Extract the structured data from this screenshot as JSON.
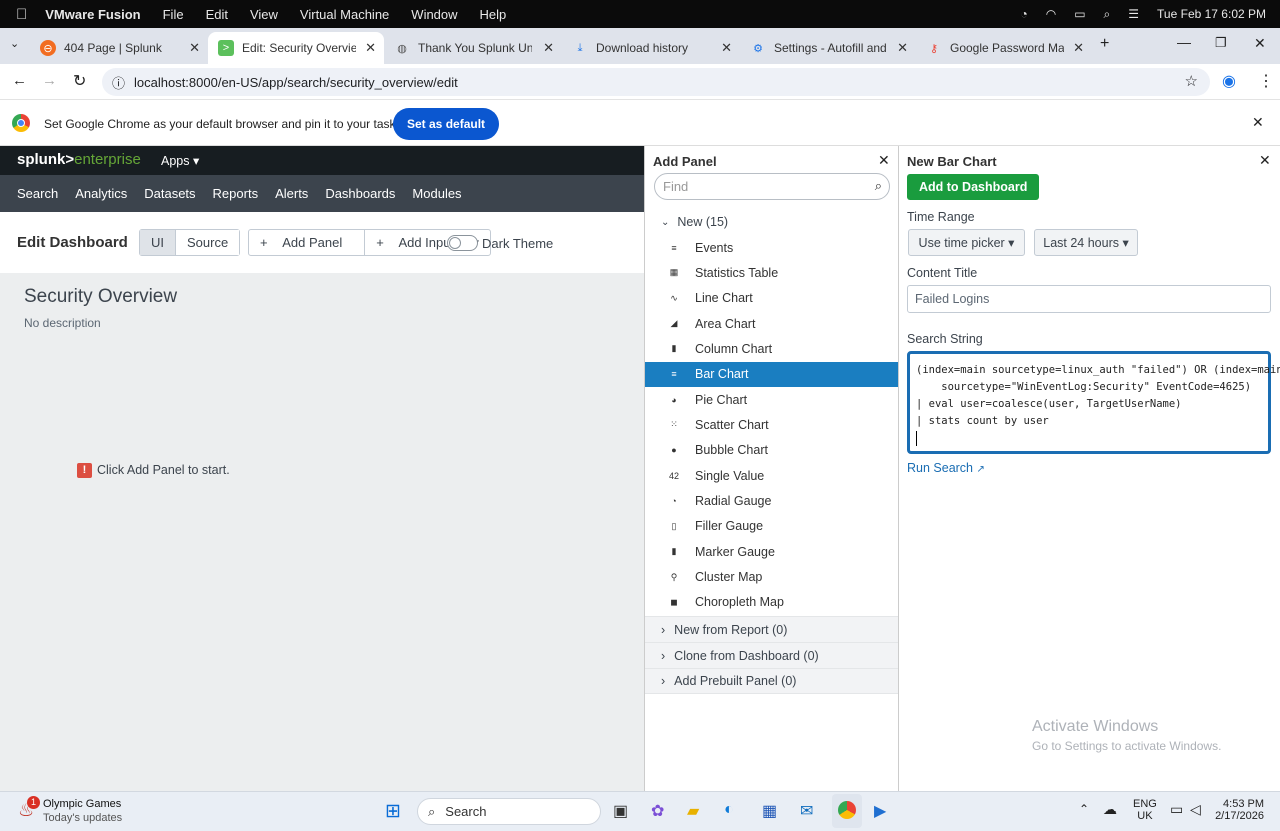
{
  "mac": {
    "app": "VMware Fusion",
    "menus": [
      "File",
      "Edit",
      "View",
      "Virtual Machine",
      "Window",
      "Help"
    ],
    "datetime": "Tue Feb 17  6:02 PM"
  },
  "tabs": [
    {
      "title": "404 Page | Splunk"
    },
    {
      "title": "Edit: Security Overview | Splunk"
    },
    {
      "title": "Thank You Splunk University"
    },
    {
      "title": "Download history"
    },
    {
      "title": "Settings - Autofill and passwords"
    },
    {
      "title": "Google Password Manager"
    }
  ],
  "url": "localhost:8000/en-US/app/search/security_overview/edit",
  "infobar": {
    "text": "Set Google Chrome as your default browser and pin it to your taskbar",
    "button": "Set as default"
  },
  "splunk": {
    "logo_a": "splunk>",
    "logo_b": "enterprise",
    "apps": "Apps",
    "nav": [
      "Search",
      "Analytics",
      "Datasets",
      "Reports",
      "Alerts",
      "Dashboards",
      "Modules"
    ],
    "edit_title": "Edit Dashboard",
    "ui": "UI",
    "source": "Source",
    "add_panel": "Add Panel",
    "add_input": "Add Input",
    "dark_theme": "Dark Theme",
    "dash_title": "Security Overview",
    "dash_desc": "No description",
    "start_msg": "Click Add Panel to start."
  },
  "add_panel": {
    "title": "Add Panel",
    "find_placeholder": "Find",
    "new_group": "New (15)",
    "items": [
      "Events",
      "Statistics Table",
      "Line Chart",
      "Area Chart",
      "Column Chart",
      "Bar Chart",
      "Pie Chart",
      "Scatter Chart",
      "Bubble Chart",
      "Single Value",
      "Radial Gauge",
      "Filler Gauge",
      "Marker Gauge",
      "Cluster Map",
      "Choropleth Map"
    ],
    "item_icons": [
      "≡",
      "▦",
      "∿",
      "◢",
      "▮",
      "≡",
      "◕",
      "⁙",
      "●",
      "42",
      "◔",
      "▯",
      "▮",
      "⚲",
      "◼"
    ],
    "selected": "Bar Chart",
    "groups": [
      "New from Report (0)",
      "Clone from Dashboard (0)",
      "Add Prebuilt Panel (0)"
    ]
  },
  "bar_panel": {
    "title": "New Bar Chart",
    "add_button": "Add to Dashboard",
    "time_label": "Time Range",
    "time_picker": "Use time picker",
    "time_range": "Last 24 hours",
    "content_label": "Content Title",
    "content_value": "Failed Logins",
    "search_label": "Search String",
    "search_lines": [
      "(index=main sourcetype=linux_auth \"failed\") OR (index=main",
      "    sourcetype=\"WinEventLog:Security\" EventCode=4625)",
      "| eval user=coalesce(user, TargetUserName)",
      "| stats count by user"
    ],
    "run_search": "Run Search"
  },
  "watermark": {
    "line1": "Activate Windows",
    "line2": "Go to Settings to activate Windows."
  },
  "taskbar": {
    "news_title": "Olympic Games",
    "news_sub": "Today's updates",
    "badge": "1",
    "search": "Search",
    "lang1": "ENG",
    "lang2": "UK",
    "time": "4:53 PM",
    "date": "2/17/2026"
  }
}
